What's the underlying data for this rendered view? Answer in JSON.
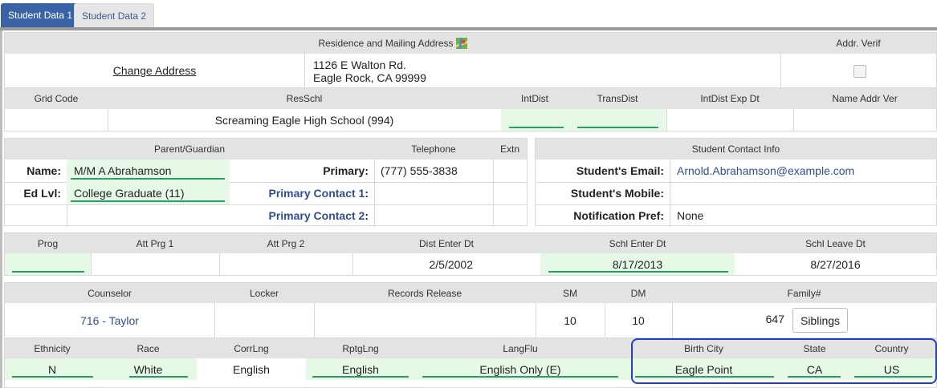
{
  "tabs": {
    "tab1": "Student Data 1",
    "tab2": "Student Data 2"
  },
  "address": {
    "header": "Residence and Mailing Address",
    "addr_verif_header": "Addr. Verif",
    "change_address": "Change Address",
    "line1": "1126 E Walton Rd.",
    "line2": "Eagle Rock, CA 99999",
    "cols": [
      "Grid Code",
      "ResSchl",
      "IntDist",
      "TransDist",
      "IntDist Exp Dt",
      "Name Addr Ver"
    ],
    "resschl_value": "Screaming Eagle High School (994)"
  },
  "parent": {
    "header": "Parent/Guardian",
    "telephone_header": "Telephone",
    "extn_header": "Extn",
    "name_label": "Name:",
    "name_value": "M/M A Abrahamson",
    "edlvl_label": "Ed Lvl:",
    "edlvl_value": "College Graduate (11)",
    "primary_label": "Primary:",
    "primary_value": "(777) 555-3838",
    "primary_contact1": "Primary Contact 1",
    "primary_contact2": "Primary Contact 2",
    "colon": ":"
  },
  "student_contact": {
    "header": "Student Contact Info",
    "email_label": "Student's Email:",
    "email_value": "Arnold.Abrahamson@example.com",
    "mobile_label": "Student's Mobile:",
    "notif_label": "Notification Pref:",
    "notif_value": "None"
  },
  "program": {
    "cols": [
      "Prog",
      "Att Prg 1",
      "Att Prg 2",
      "Dist Enter Dt",
      "Schl Enter Dt",
      "Schl Leave Dt"
    ],
    "dist_enter": "2/5/2002",
    "schl_enter": "8/17/2013",
    "schl_leave": "8/27/2016"
  },
  "counselor": {
    "cols": [
      "Counselor",
      "Locker",
      "Records Release",
      "SM",
      "DM",
      "Family#"
    ],
    "counselor_value": "716 - Taylor",
    "sm": "10",
    "dm": "10",
    "family": "647",
    "siblings_button": "Siblings"
  },
  "demographics": {
    "cols": [
      "Ethnicity",
      "Race",
      "CorrLng",
      "RptgLng",
      "LangFlu",
      "Birth City",
      "State",
      "Country"
    ],
    "ethnicity": "N",
    "race": "White",
    "corrlng": "English",
    "rptglng": "English",
    "langflu": "English Only (E)",
    "birth_city": "Eagle Point",
    "state": "CA",
    "country": "US"
  },
  "colors": {
    "accent": "#3a63a6",
    "field_green": "#e6f9e6",
    "underline": "#2f9a6a",
    "highlight": "#2040c0"
  }
}
